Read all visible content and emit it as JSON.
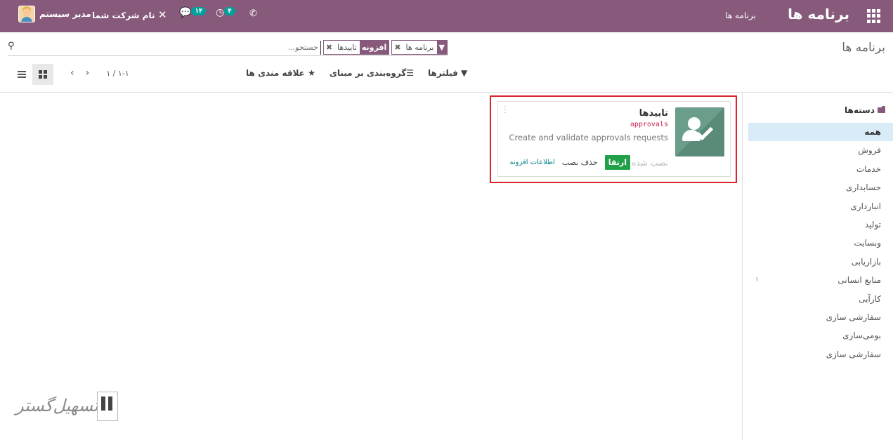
{
  "navbar": {
    "brand": "برنامه ها",
    "menu": "برنامه ها",
    "user_name": "مدیر سیستم",
    "company": "نام شرکت شما",
    "chat_badge": "۱۴",
    "activity_badge": "۴",
    "debug_icon": "bug-icon",
    "phone_icon": "phone-icon"
  },
  "control_panel": {
    "breadcrumb": "برنامه ها",
    "search": {
      "placeholder": "جستجو...",
      "facets": [
        {
          "label": "",
          "values": "برنامه ها"
        },
        {
          "label": "افزونه",
          "values": "تاییدها"
        }
      ]
    },
    "filters_label": "فیلترها",
    "groupby_label": "گروه‌بندی بر مبنای",
    "favorites_label": "علاقه مندی ها",
    "pager": {
      "value": "۱-۱ / ۱"
    }
  },
  "sidebar": {
    "title": "دسته‌ها",
    "items": [
      {
        "label": "همه",
        "count": ""
      },
      {
        "label": "فروش",
        "count": ""
      },
      {
        "label": "خدمات",
        "count": ""
      },
      {
        "label": "حسابداری",
        "count": ""
      },
      {
        "label": "انبارداری",
        "count": ""
      },
      {
        "label": "تولید",
        "count": ""
      },
      {
        "label": "وبسایت",
        "count": ""
      },
      {
        "label": "بازاریابی",
        "count": ""
      },
      {
        "label": "منابع انسانی",
        "count": "۱"
      },
      {
        "label": "کارآیی",
        "count": ""
      },
      {
        "label": "سفارشی سازی",
        "count": ""
      },
      {
        "label": "بومی‌سازی",
        "count": ""
      },
      {
        "label": "سفارشی سازی",
        "count": ""
      }
    ]
  },
  "card": {
    "title": "تاییدها",
    "technical_name": "approvals",
    "summary": "Create and validate approvals requests",
    "status": "نصب شده",
    "upgrade": "ارتقا",
    "uninstall": "حذف نصب",
    "info": "اطلاعات افزونه"
  },
  "watermark": {
    "text": "تسهیل‌گستر"
  },
  "colors": {
    "navbar": "#875a7b",
    "upgrade": "#21a04a",
    "highlight": "#d9232d",
    "active_item": "#d9ebf7"
  }
}
